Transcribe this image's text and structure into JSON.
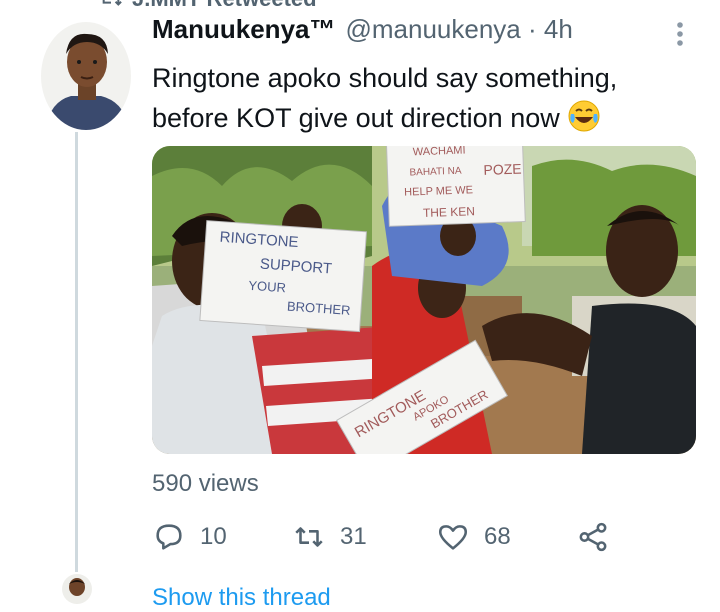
{
  "retweet": {
    "label": "J.MMT Retweeted",
    "icon": "retweet-icon"
  },
  "tweet": {
    "author_name": "Manuukenya™",
    "handle": "@manuukenya · 4h",
    "text": "Ringtone apoko should say something, before KOT give out direction now",
    "emoji": "face-with-tears-of-joy",
    "views": "590 views",
    "stats": {
      "replies": "10",
      "retweets": "31",
      "likes": "68"
    },
    "media": {
      "signs": {
        "left": [
          "RINGTONE",
          "SUPPORT",
          "YOUR",
          "BROTHER"
        ],
        "top": [
          "WACHAMI",
          "BAHATI NA",
          "POZE",
          "HELP ME WE",
          "THE KEN"
        ],
        "bottom": [
          "RINGTONE",
          "APOKO",
          "BROTHER"
        ]
      }
    }
  },
  "show_thread": "Show this thread",
  "colors": {
    "secondary": "#536471",
    "accent": "#1d9bf0",
    "line": "#cfd9de"
  }
}
